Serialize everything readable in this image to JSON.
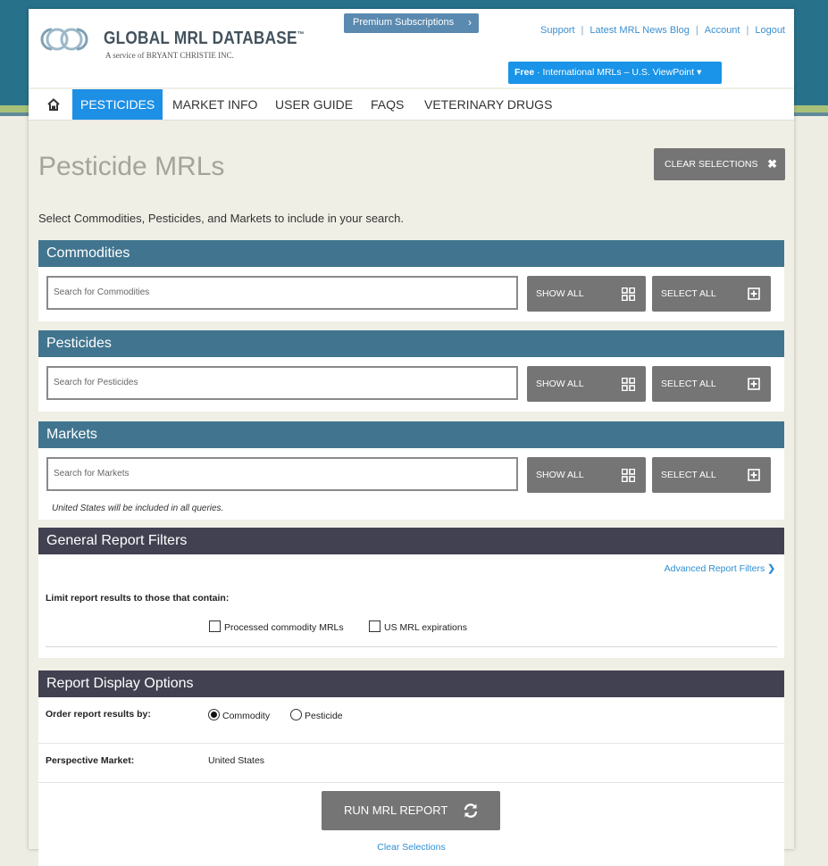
{
  "header": {
    "logo_title": "GLOBAL MRL DATABASE",
    "logo_tm": "™",
    "logo_sub": "A service of BRYANT CHRISTIE INC.",
    "premium_label": "Premium Subscriptions",
    "links": [
      "Support",
      "Latest MRL News Blog",
      "Account",
      "Logout"
    ],
    "free_bold": "Free",
    "free_text": "· International MRLs – U.S. ViewPoint ▾"
  },
  "nav": {
    "items": [
      "PESTICIDES",
      "MARKET INFO",
      "USER GUIDE",
      "FAQS",
      "VETERINARY DRUGS"
    ]
  },
  "page": {
    "title": "Pesticide MRLs",
    "clear_selections": "CLEAR SELECTIONS",
    "intro": "Select Commodities, Pesticides, and Markets to include in your search."
  },
  "commodities": {
    "heading": "Commodities",
    "placeholder": "Search for Commodities",
    "show_all": "SHOW ALL",
    "select_all": "SELECT ALL"
  },
  "pesticides": {
    "heading": "Pesticides",
    "placeholder": "Search for Pesticides",
    "show_all": "SHOW ALL",
    "select_all": "SELECT ALL"
  },
  "markets": {
    "heading": "Markets",
    "placeholder": "Search for Markets",
    "show_all": "SHOW ALL",
    "select_all": "SELECT ALL",
    "note": "United States will be included in all queries."
  },
  "filters": {
    "heading": "General Report Filters",
    "advanced_link": "Advanced Report Filters",
    "limit_label": "Limit report results to those that contain:",
    "options": [
      "Processed commodity MRLs",
      "US MRL expirations"
    ]
  },
  "display": {
    "heading": "Report Display Options",
    "order_label": "Order report results by:",
    "order_options": [
      "Commodity",
      "Pesticide"
    ],
    "order_selected": "Commodity",
    "perspective_label": "Perspective Market:",
    "perspective_value": "United States",
    "run_button": "RUN MRL REPORT",
    "clear_link": "Clear Selections"
  },
  "colors": {
    "accent_blue": "#1d8fe5",
    "section_blue": "#41758f",
    "section_dark": "#414151",
    "button_gray": "#757575"
  }
}
